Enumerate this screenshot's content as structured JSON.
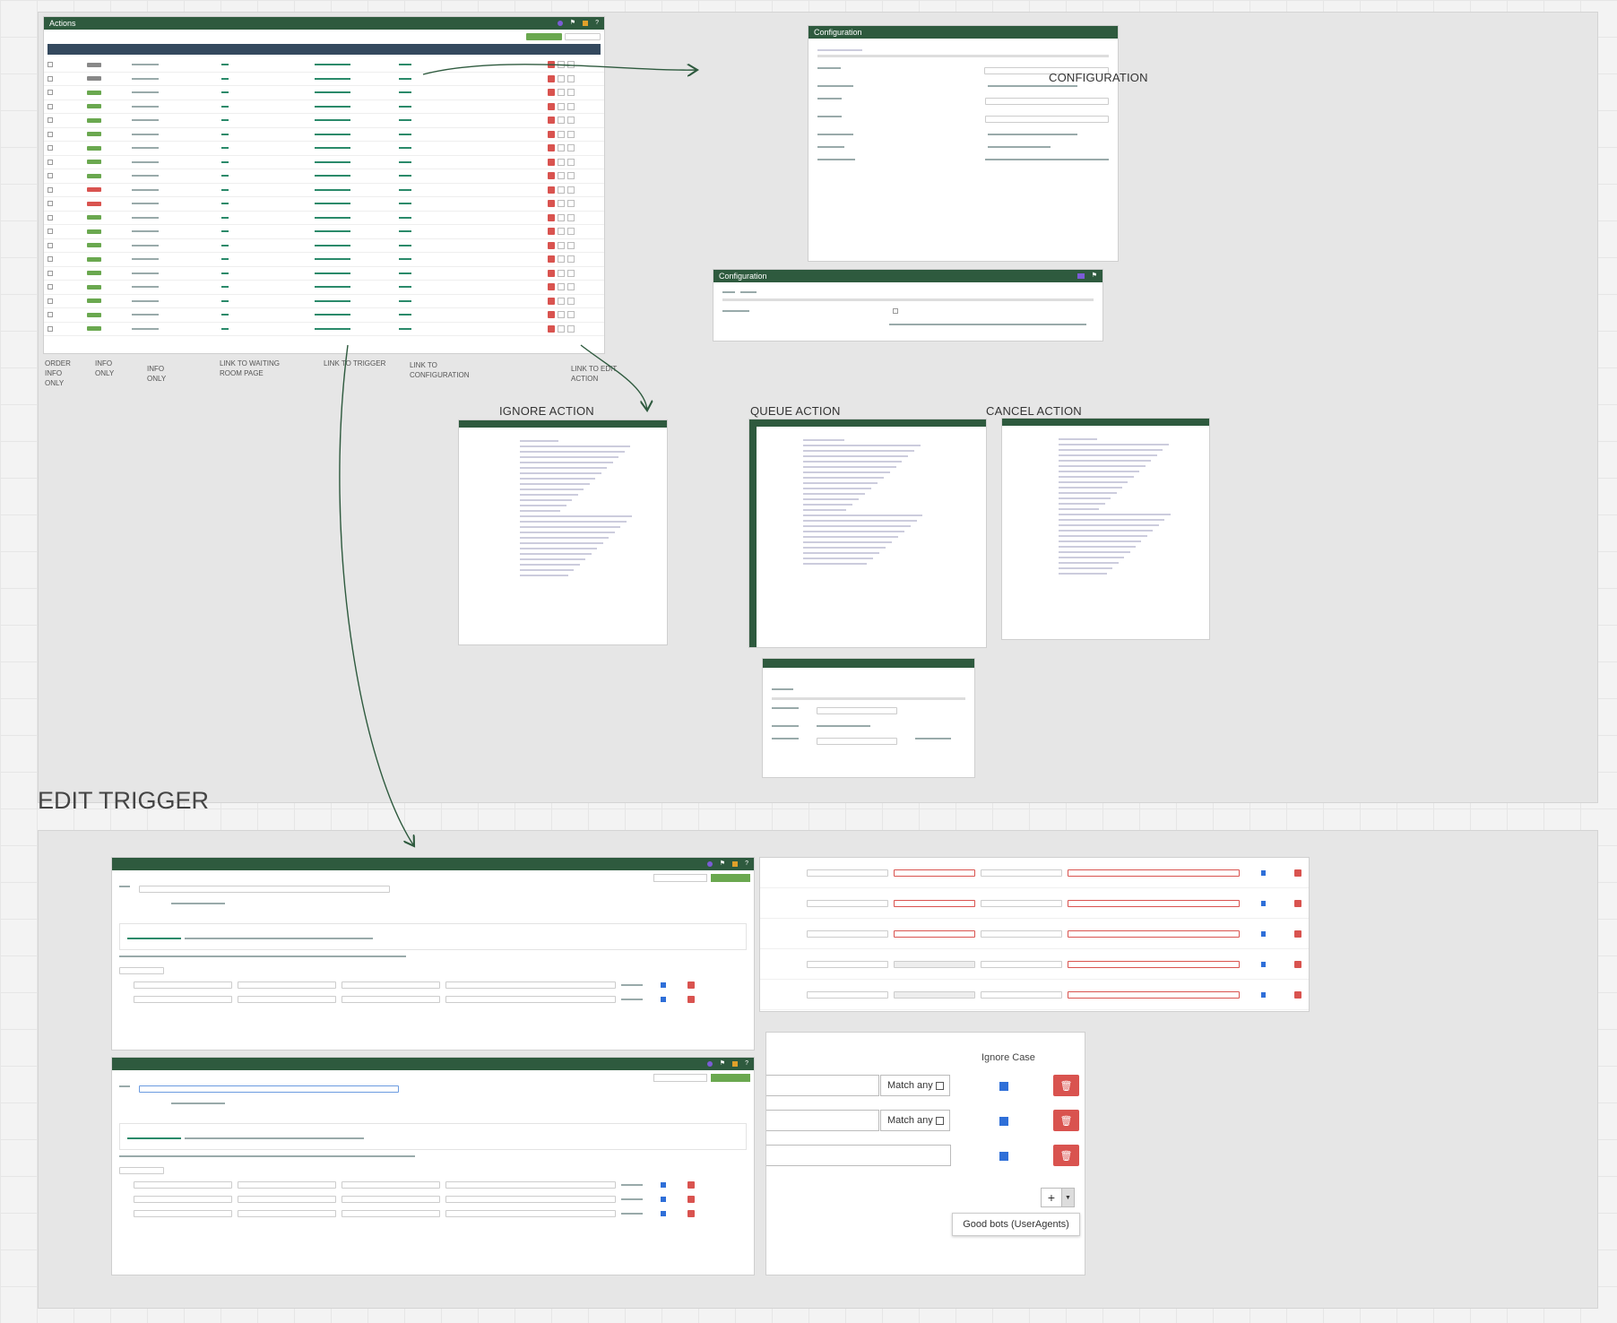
{
  "captions": {
    "order": "ORDER\nINFO\nONLY",
    "type": "INFO\nONLY",
    "name": "INFO\nONLY",
    "waiting": "LINK TO WAITING\nROOM PAGE",
    "trigger": "LINK TO TRIGGER",
    "configuration": "LINK TO\nCONFIGURATION",
    "edit": "LINK TO EDIT\nACTION"
  },
  "headings": {
    "configuration": "CONFIGURATION",
    "ignore": "IGNORE ACTION",
    "queue": "QUEUE ACTION",
    "cancel": "CANCEL ACTION",
    "edit_trigger": "EDIT TRIGGER"
  },
  "actions_panel": {
    "title": "Actions"
  },
  "config_panel": {
    "title": "Configuration"
  },
  "config_panel2": {
    "title": "Configuration"
  },
  "zoom_panel": {
    "header": "Ignore Case",
    "match_any": [
      "Match any",
      "Match any"
    ],
    "tooltip": "Good bots (UserAgents)",
    "add_symbol": "+"
  },
  "colors": {
    "brand": "#2e5a3e",
    "delete": "#d9534f",
    "checkbox": "#2f6fd8",
    "arrow": "#2e5a3e"
  }
}
